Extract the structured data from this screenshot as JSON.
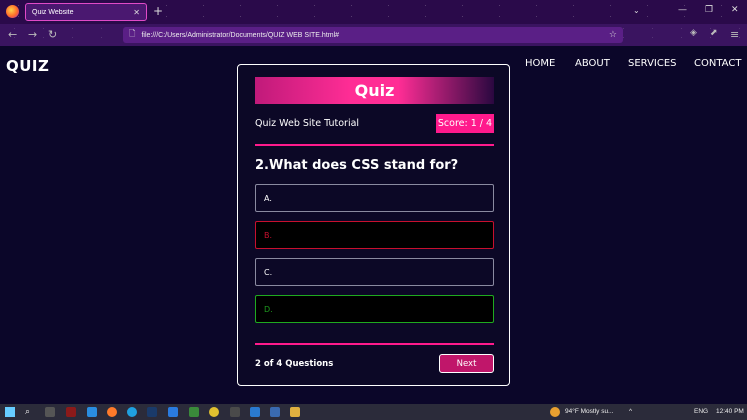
{
  "browser": {
    "tab_title": "Quiz Website",
    "tab_close": "✕",
    "new_tab": "+",
    "tabs_menu": "⌄",
    "minimize": "—",
    "maximize": "❐",
    "close": "✕",
    "back": "←",
    "forward": "→",
    "reload": "↻",
    "url": "file:///C:/Users/Administrator/Documents/QUIZ WEB SITE.html#",
    "page_icon": "🗋",
    "bookmark": "☆",
    "pocket": "◈",
    "extensions": "⬈",
    "menu": "≡"
  },
  "site": {
    "logo": "QUIZ",
    "nav": [
      "HOME",
      "ABOUT",
      "SERVICES",
      "CONTACT"
    ]
  },
  "quiz": {
    "title": "Quiz",
    "subtitle": "Quiz Web Site Tutorial",
    "score": "Score: 1 / 4",
    "question": "2.What does CSS stand for?",
    "options": [
      {
        "label": "A.",
        "state": "neutral"
      },
      {
        "label": "B.",
        "state": "wrong"
      },
      {
        "label": "C.",
        "state": "neutral"
      },
      {
        "label": "D.",
        "state": "correct"
      }
    ],
    "progress": "2 of 4 Questions",
    "next_label": "Next"
  },
  "colors": {
    "accent": "#ff1a8c",
    "background": "#0b0629",
    "wrong": "#c8102e",
    "correct": "#1faa1f"
  },
  "taskbar": {
    "search": "⌕",
    "weather": "94°F  Mostly su...",
    "tray_up": "^",
    "language": "ENG",
    "time": "12:40 PM"
  }
}
